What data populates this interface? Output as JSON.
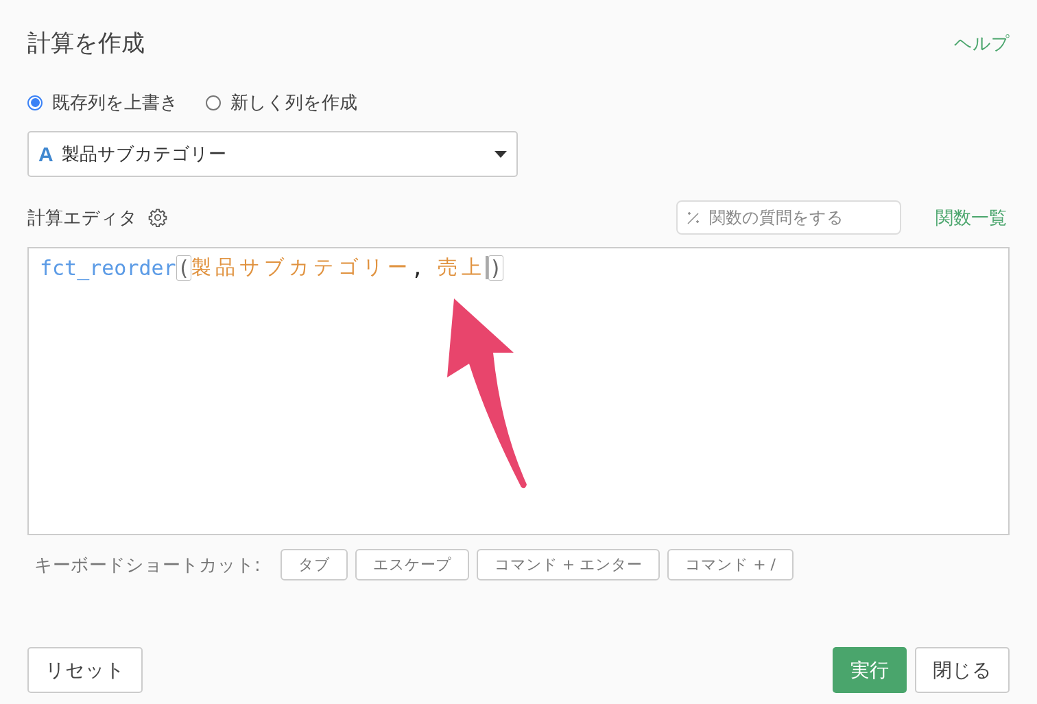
{
  "title": "計算を作成",
  "help_link": "ヘルプ",
  "mode_options": [
    {
      "label": "既存列を上書き",
      "selected": true
    },
    {
      "label": "新しく列を作成",
      "selected": false
    }
  ],
  "column_select": {
    "type_icon": "A",
    "value": "製品サブカテゴリー"
  },
  "editor": {
    "label": "計算エディタ",
    "ask_placeholder": "関数の質問をする",
    "function_list_link": "関数一覧",
    "code": [
      {
        "kind": "function",
        "text": "fct_reorder"
      },
      {
        "kind": "paren",
        "text": "("
      },
      {
        "kind": "column",
        "text": "製品サブカテゴリー"
      },
      {
        "kind": "punct",
        "text": ","
      },
      {
        "kind": "column",
        "text": "売上"
      },
      {
        "kind": "paren",
        "text": ")"
      }
    ]
  },
  "shortcuts": {
    "label": "キーボードショートカット:",
    "keys": [
      "タブ",
      "エスケープ",
      "コマンド + エンター",
      "コマンド + /"
    ]
  },
  "buttons": {
    "reset": "リセット",
    "run": "実行",
    "close": "閉じる"
  }
}
